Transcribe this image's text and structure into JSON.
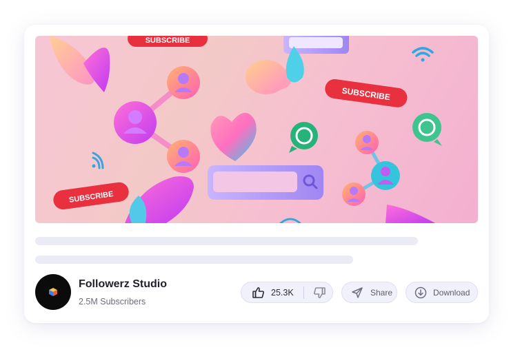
{
  "channel": {
    "name": "Followerz Studio",
    "subscribers": "2.5M Subscribers",
    "avatar_icon": "cube-logo-icon"
  },
  "actions": {
    "likes": "25.3K",
    "share_label": "Share",
    "download_label": "Download"
  },
  "thumbnail": {
    "subscribe_text": "SUBSCRIBE",
    "icons": [
      "subscribe-button",
      "wifi-icon",
      "whatsapp-icon",
      "user-profile-icon",
      "heart-icon",
      "search-bar-icon"
    ]
  },
  "colors": {
    "pill_bg": "#f1f1fb",
    "skeleton": "#ebebf6",
    "subscribe_red": "#e8303f",
    "text_dark": "#1f1f2b"
  }
}
